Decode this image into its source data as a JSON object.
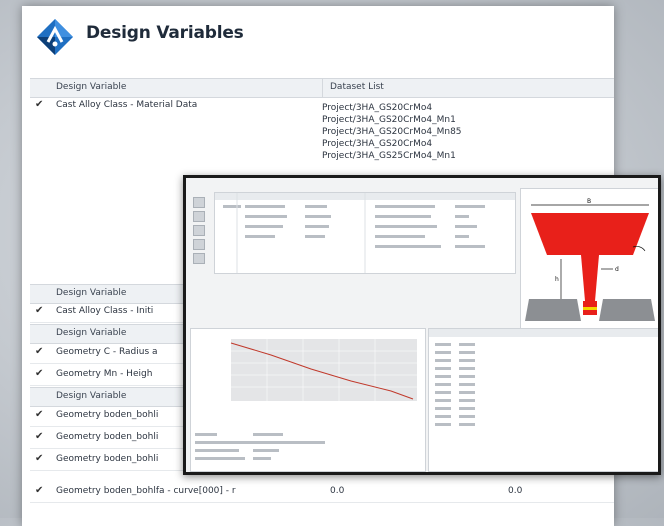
{
  "window": {
    "title": "Design Variables"
  },
  "table": {
    "column_headers": [
      "Design Variable",
      "Dataset List"
    ],
    "group_header_label": "Design Variable",
    "rows_top": [
      {
        "checked": true,
        "label": "Cast Alloy Class - Material Data"
      }
    ],
    "dataset_list": [
      "Project/3HA_GS20CrMo4",
      "Project/3HA_GS20CrMo4_Mn1",
      "Project/3HA_GS20CrMo4_Mn85",
      "Project/3HA_GS20CrMo4",
      "Project/3HA_GS25CrMo4_Mn1"
    ],
    "row_group2": [
      {
        "checked": true,
        "label": "Cast Alloy Class - Initi"
      }
    ],
    "row_group3": [
      {
        "checked": true,
        "label": "Geometry C - Radius a"
      },
      {
        "checked": true,
        "label": "Geometry Mn - Heigh"
      }
    ],
    "row_group4": [
      {
        "checked": true,
        "label": "Geometry boden_bohli"
      },
      {
        "checked": true,
        "label": "Geometry boden_bohli"
      },
      {
        "checked": true,
        "label": "Geometry boden_bohli"
      },
      {
        "checked": true,
        "label": "Geometry boden_bohlfa - curve[000] - r",
        "v1": "0.0",
        "v2": "0.0"
      }
    ]
  },
  "icons": {
    "logo": "design-variables-logo-icon",
    "check": "checkmark-icon"
  },
  "colors": {
    "logo_blue": "#1f6fc2",
    "logo_dark": "#0d3f78",
    "melt_red": "#e8201a",
    "mold_gray": "#8c8f93"
  }
}
